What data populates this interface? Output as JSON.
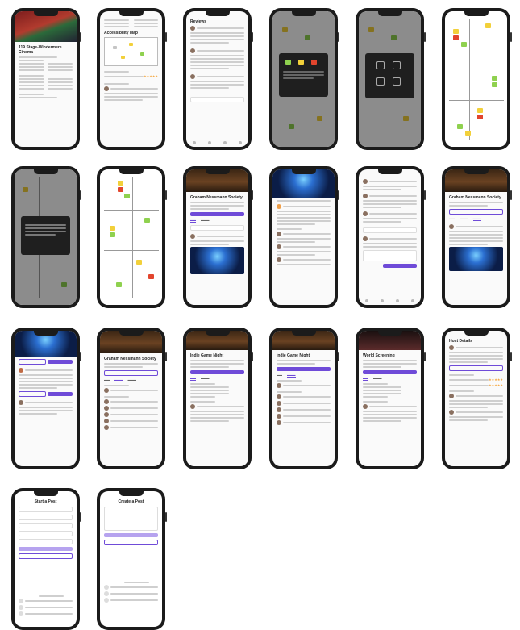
{
  "screens": [
    {
      "id": 1,
      "title": "119 Stage-Windermere Cinema",
      "kind": "venue"
    },
    {
      "id": 2,
      "title": "Accessibility Map",
      "kind": "venue-map"
    },
    {
      "id": 3,
      "title": "Reviews",
      "kind": "reviews"
    },
    {
      "id": 4,
      "title": "",
      "kind": "modal-color"
    },
    {
      "id": 5,
      "title": "",
      "kind": "modal-icons"
    },
    {
      "id": 6,
      "title": "",
      "kind": "floorplan"
    },
    {
      "id": 7,
      "title": "",
      "kind": "floorplan-modal"
    },
    {
      "id": 8,
      "title": "",
      "kind": "floorplan"
    },
    {
      "id": 9,
      "title": "Graham Nessmann Society",
      "kind": "event"
    },
    {
      "id": 10,
      "title": "",
      "kind": "concert-feed"
    },
    {
      "id": 11,
      "title": "",
      "kind": "comments"
    },
    {
      "id": 12,
      "title": "Graham Nessmann Society",
      "kind": "event-discuss"
    },
    {
      "id": 13,
      "title": "",
      "kind": "post"
    },
    {
      "id": 14,
      "title": "Graham Nessmann Society",
      "kind": "event-attendees"
    },
    {
      "id": 15,
      "title": "Indie Game Night",
      "kind": "event-detail"
    },
    {
      "id": 16,
      "title": "Indie Game Night",
      "kind": "event-attendees"
    },
    {
      "id": 17,
      "title": "World Screening",
      "kind": "event-detail"
    },
    {
      "id": 18,
      "title": "Host Details",
      "kind": "host-review"
    },
    {
      "id": 19,
      "title": "Start a Post",
      "kind": "form"
    },
    {
      "id": 20,
      "title": "Create a Post",
      "kind": "form"
    }
  ]
}
